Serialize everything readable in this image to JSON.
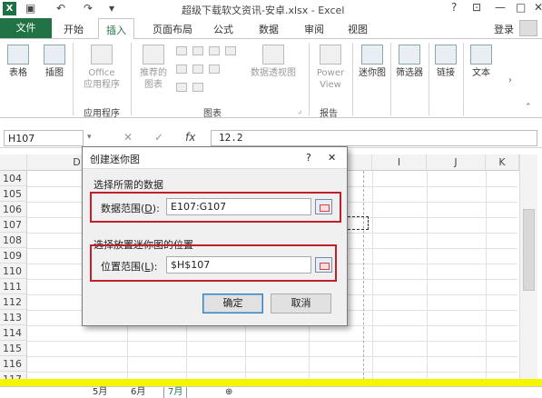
{
  "window": {
    "title": "超级下载软文资讯-安卓.xlsx - Excel",
    "help": "?",
    "controls": [
      "—",
      "□",
      "✕"
    ]
  },
  "ribbon_tabs": {
    "file": "文件",
    "items": [
      "开始",
      "插入",
      "页面布局",
      "公式",
      "数据",
      "审阅",
      "视图"
    ],
    "selected": "插入",
    "signin": "登录"
  },
  "ribbon": {
    "table": "表格",
    "illustrations": "插图",
    "office": "Office",
    "apps": "应用程序",
    "apps_group": "应用程序",
    "recommended": "推荐的",
    "chart": "图表",
    "pivotchart": "数据透视图",
    "power": "Power",
    "view": "View",
    "reports_group": "报告",
    "charts_group": "图表",
    "sparklines": "迷你图",
    "filters": "筛选器",
    "links": "链接",
    "text": "文本"
  },
  "formula_bar": {
    "name_box": "H107",
    "cancel": "✕",
    "enter": "✓",
    "fx": "fx",
    "value": "12.2"
  },
  "grid": {
    "columns": [
      "D",
      "I",
      "J",
      "K"
    ],
    "rows": [
      "104",
      "105",
      "106",
      "107",
      "108",
      "109",
      "110",
      "111",
      "112",
      "113",
      "114",
      "115",
      "116",
      "117"
    ]
  },
  "sheets": {
    "tabs": [
      "5月",
      "6月",
      "7月"
    ],
    "add": "⊕"
  },
  "dialog": {
    "title": "创建迷你图",
    "help": "?",
    "close": "✕",
    "section1": "选择所需的数据",
    "data_range_label": "数据范围(",
    "data_range_key": "D",
    "data_range_value": "E107:G107",
    "section2": "选择放置迷你图的位置",
    "location_label": "位置范围(",
    "location_key": "L",
    "location_value": "$H$107",
    "ok": "确定",
    "cancel": "取消"
  },
  "colors": {
    "excel_green": "#217346",
    "highlight_red": "#c0202a",
    "sheet_yellow": "#f5f500"
  }
}
